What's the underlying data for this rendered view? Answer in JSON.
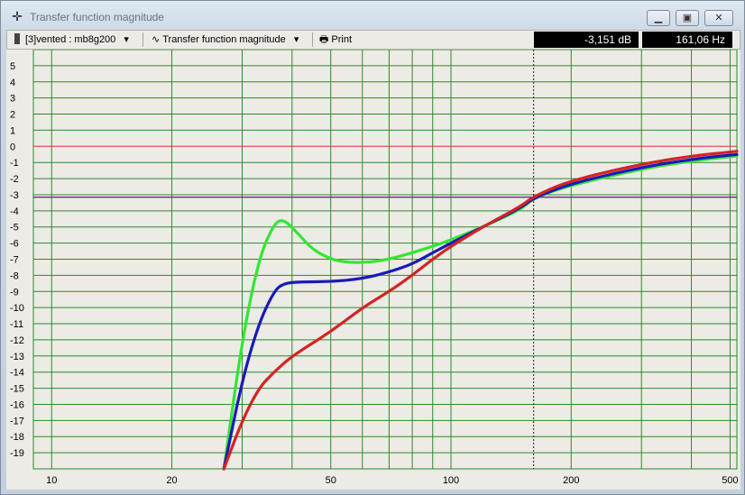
{
  "window": {
    "title": "Transfer function magnitude",
    "app_icon": "crosshair-icon",
    "controls": {
      "minimize": "minimize-icon",
      "restore": "restore-icon",
      "close": "close-icon"
    }
  },
  "toolbar": {
    "project_label": "[3]vented : mb8g200",
    "view_label": "Transfer function magnitude",
    "print_label": "Print",
    "readout_db": "-3,151 dB",
    "readout_hz": "161,06 Hz"
  },
  "colors": {
    "grid": "#2d8a2d",
    "zero_line": "#e03030",
    "cursor_line": "#6b2a80",
    "green_series": "#33e633",
    "blue_series": "#1a1ab8",
    "red_series": "#d42424",
    "background": "#ecebe5"
  },
  "chart_data": {
    "type": "line",
    "title": "Transfer function magnitude",
    "xlabel": "",
    "ylabel": "",
    "x_scale": "log",
    "xlim": [
      9,
      520
    ],
    "ylim": [
      -20,
      6
    ],
    "x_ticks": [
      "10",
      "20",
      "50",
      "100",
      "200",
      "500"
    ],
    "y_ticks": [
      "5",
      "4",
      "3",
      "2",
      "1",
      "0",
      "-1",
      "-2",
      "-3",
      "-4",
      "-5",
      "-6",
      "-7",
      "-8",
      "-9",
      "-10",
      "-11",
      "-12",
      "-13",
      "-14",
      "-15",
      "-16",
      "-17",
      "-18",
      "-19"
    ],
    "grid": true,
    "cursor": {
      "x": 161.06,
      "y": -3.151
    },
    "series": [
      {
        "color": "green",
        "points": [
          [
            27,
            -20
          ],
          [
            30,
            -12
          ],
          [
            33,
            -7
          ],
          [
            36,
            -4.8
          ],
          [
            38,
            -4.5
          ],
          [
            41,
            -5.3
          ],
          [
            45,
            -6.4
          ],
          [
            50,
            -7
          ],
          [
            55,
            -7.2
          ],
          [
            62,
            -7.2
          ],
          [
            70,
            -7.0
          ],
          [
            80,
            -6.6
          ],
          [
            90,
            -6.2
          ],
          [
            100,
            -5.8
          ],
          [
            120,
            -5
          ],
          [
            150,
            -3.9
          ],
          [
            161,
            -3.2
          ],
          [
            200,
            -2.4
          ],
          [
            300,
            -1.4
          ],
          [
            400,
            -0.9
          ],
          [
            520,
            -0.6
          ]
        ]
      },
      {
        "color": "blue",
        "points": [
          [
            27,
            -20
          ],
          [
            30,
            -14.5
          ],
          [
            33,
            -11
          ],
          [
            36,
            -9
          ],
          [
            38,
            -8.5
          ],
          [
            42,
            -8.4
          ],
          [
            50,
            -8.4
          ],
          [
            60,
            -8.2
          ],
          [
            70,
            -7.8
          ],
          [
            80,
            -7.3
          ],
          [
            90,
            -6.6
          ],
          [
            100,
            -6.0
          ],
          [
            120,
            -5
          ],
          [
            150,
            -3.8
          ],
          [
            161,
            -3.2
          ],
          [
            200,
            -2.3
          ],
          [
            300,
            -1.3
          ],
          [
            400,
            -0.8
          ],
          [
            520,
            -0.5
          ]
        ]
      },
      {
        "color": "red",
        "points": [
          [
            27,
            -20
          ],
          [
            30,
            -17
          ],
          [
            33,
            -15
          ],
          [
            36,
            -14
          ],
          [
            40,
            -13
          ],
          [
            50,
            -11.5
          ],
          [
            60,
            -10
          ],
          [
            70,
            -9
          ],
          [
            80,
            -8
          ],
          [
            90,
            -7
          ],
          [
            100,
            -6.2
          ],
          [
            120,
            -5
          ],
          [
            150,
            -3.7
          ],
          [
            161,
            -3.1
          ],
          [
            200,
            -2.1
          ],
          [
            300,
            -1.1
          ],
          [
            400,
            -0.6
          ],
          [
            520,
            -0.3
          ]
        ]
      }
    ]
  }
}
